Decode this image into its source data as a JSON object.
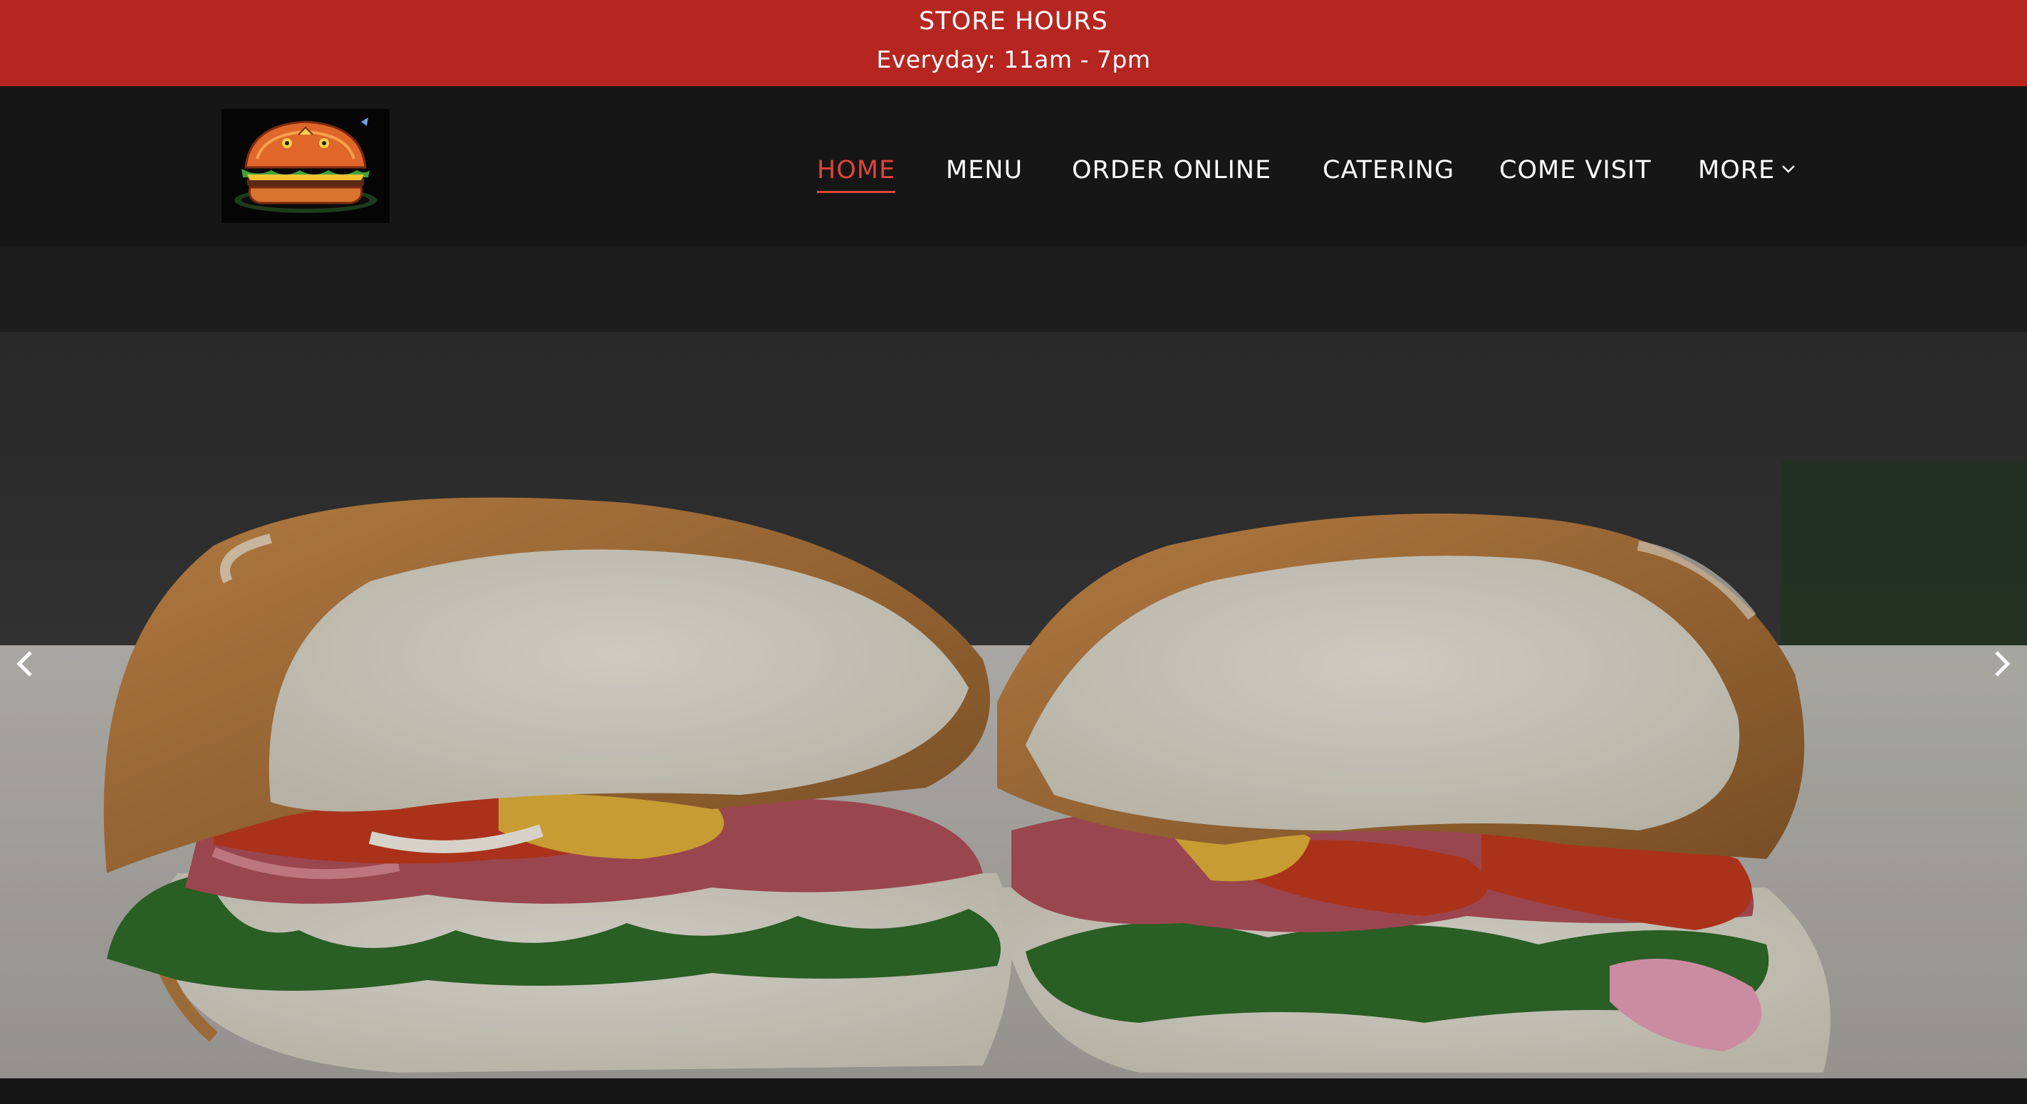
{
  "announcement": {
    "title": "STORE HOURS",
    "hours": "Everyday: 11am - 7pm",
    "background": "#b52620"
  },
  "header": {
    "logo_icon": "burger-logo-icon",
    "nav": {
      "home": "HOME",
      "menu": "MENU",
      "order_online": "ORDER ONLINE",
      "catering": "CATERING",
      "come_visit": "COME VISIT",
      "more": "MORE"
    },
    "active_item": "HOME",
    "active_color": "#e0443a"
  },
  "hero": {
    "image": "italian-sub-sandwich-photo",
    "prev_icon": "chevron-left-icon",
    "next_icon": "chevron-right-icon"
  }
}
